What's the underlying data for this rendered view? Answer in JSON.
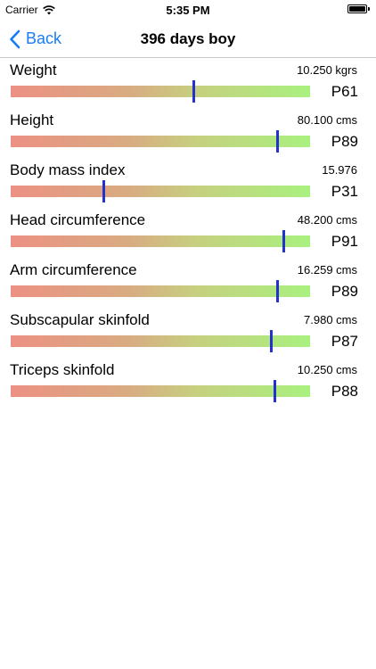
{
  "status_bar": {
    "carrier": "Carrier",
    "time": "5:35 PM"
  },
  "nav": {
    "back_label": "Back",
    "title": "396 days boy"
  },
  "colors": {
    "accent": "#1a7cf5",
    "marker": "#2233cc",
    "bar_low": "#ec9083",
    "bar_high": "#a9f17f"
  },
  "rows": [
    {
      "name": "Weight",
      "value": "10.250 kgrs",
      "percentile": "P61",
      "level": 0.61
    },
    {
      "name": "Height",
      "value": "80.100 cms",
      "percentile": "P89",
      "level": 0.89
    },
    {
      "name": "Body mass index",
      "value": "15.976",
      "percentile": "P31",
      "level": 0.31
    },
    {
      "name": "Head circumference",
      "value": "48.200 cms",
      "percentile": "P91",
      "level": 0.91
    },
    {
      "name": "Arm circumference",
      "value": "16.259 cms",
      "percentile": "P89",
      "level": 0.89
    },
    {
      "name": "Subscapular skinfold",
      "value": "7.980 cms",
      "percentile": "P87",
      "level": 0.87
    },
    {
      "name": "Triceps skinfold",
      "value": "10.250 cms",
      "percentile": "P88",
      "level": 0.88
    }
  ]
}
